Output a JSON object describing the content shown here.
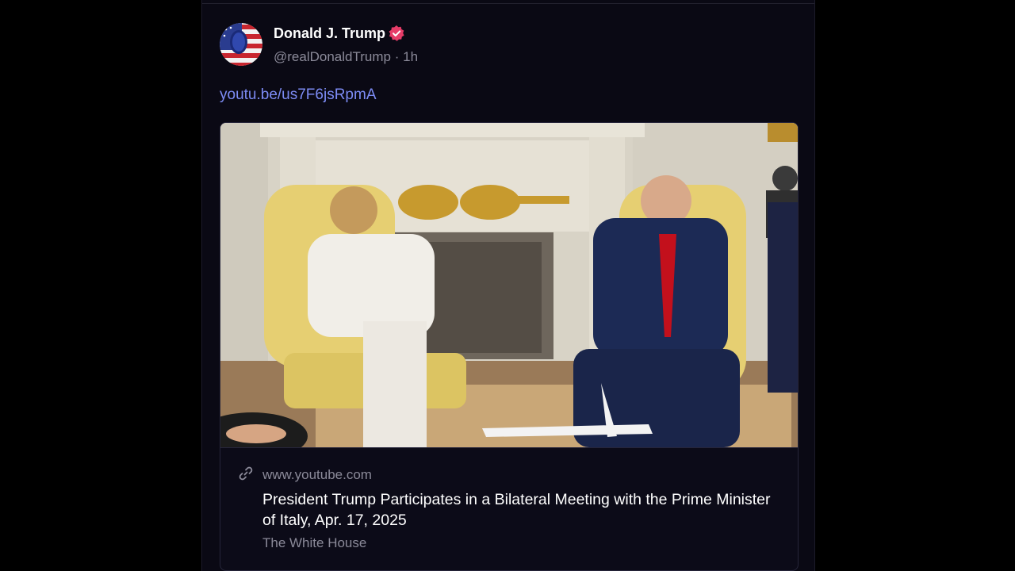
{
  "post": {
    "author": {
      "name": "Donald J. Trump",
      "handle": "@realDonaldTrump",
      "separator": "·",
      "time": "1h",
      "verified": true,
      "avatar_icon": "flag-portrait-avatar"
    },
    "link_text": "youtu.be/us7F6jsRpmA",
    "card": {
      "domain": "www.youtube.com",
      "title": "President Trump Participates in a Bilateral Meeting with the Prime Minister of Italy, Apr. 17, 2025",
      "source": "The White House",
      "thumbnail_icon": "video-thumbnail-meeting-scene",
      "link_icon": "chain-link-icon"
    }
  },
  "colors": {
    "background": "#000000",
    "panel": "#0a0914",
    "link": "#7d8cf5",
    "muted": "#8b8a99",
    "verified_badge": "#e63c68",
    "text": "#ffffff"
  }
}
